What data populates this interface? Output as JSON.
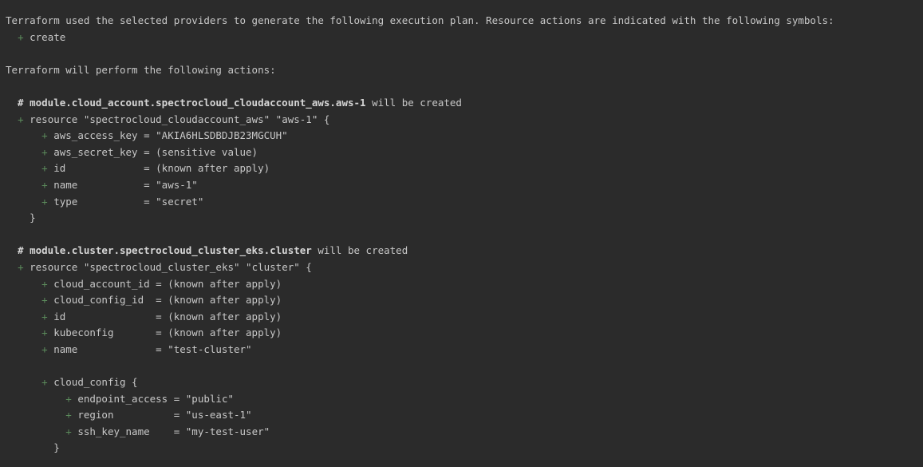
{
  "lines": [
    {
      "parts": [
        {
          "text": "Terraform used the selected providers to generate the following execution plan. Resource actions are indicated with the following symbols:",
          "style": "normal"
        }
      ]
    },
    {
      "parts": [
        {
          "text": "  ",
          "style": "normal"
        },
        {
          "text": "+",
          "style": "plus"
        },
        {
          "text": " create",
          "style": "normal"
        }
      ]
    },
    {
      "parts": []
    },
    {
      "parts": [
        {
          "text": "Terraform will perform the following actions:",
          "style": "normal"
        }
      ]
    },
    {
      "parts": []
    },
    {
      "parts": [
        {
          "text": "  # ",
          "style": "bold"
        },
        {
          "text": "module.cloud_account.spectrocloud_cloudaccount_aws.aws-1",
          "style": "bold"
        },
        {
          "text": " will be created",
          "style": "normal"
        }
      ]
    },
    {
      "parts": [
        {
          "text": "  ",
          "style": "normal"
        },
        {
          "text": "+",
          "style": "plus"
        },
        {
          "text": " resource \"spectrocloud_cloudaccount_aws\" \"aws-1\" {",
          "style": "normal"
        }
      ]
    },
    {
      "parts": [
        {
          "text": "      ",
          "style": "normal"
        },
        {
          "text": "+",
          "style": "plus"
        },
        {
          "text": " aws_access_key = \"AKIA6HLSDBDJB23MGCUH\"",
          "style": "normal"
        }
      ]
    },
    {
      "parts": [
        {
          "text": "      ",
          "style": "normal"
        },
        {
          "text": "+",
          "style": "plus"
        },
        {
          "text": " aws_secret_key = (sensitive value)",
          "style": "normal"
        }
      ]
    },
    {
      "parts": [
        {
          "text": "      ",
          "style": "normal"
        },
        {
          "text": "+",
          "style": "plus"
        },
        {
          "text": " id             = (known after apply)",
          "style": "normal"
        }
      ]
    },
    {
      "parts": [
        {
          "text": "      ",
          "style": "normal"
        },
        {
          "text": "+",
          "style": "plus"
        },
        {
          "text": " name           = \"aws-1\"",
          "style": "normal"
        }
      ]
    },
    {
      "parts": [
        {
          "text": "      ",
          "style": "normal"
        },
        {
          "text": "+",
          "style": "plus"
        },
        {
          "text": " type           = \"secret\"",
          "style": "normal"
        }
      ]
    },
    {
      "parts": [
        {
          "text": "    }",
          "style": "normal"
        }
      ]
    },
    {
      "parts": []
    },
    {
      "parts": [
        {
          "text": "  # ",
          "style": "bold"
        },
        {
          "text": "module.cluster.spectrocloud_cluster_eks.cluster",
          "style": "bold"
        },
        {
          "text": " will be created",
          "style": "normal"
        }
      ]
    },
    {
      "parts": [
        {
          "text": "  ",
          "style": "normal"
        },
        {
          "text": "+",
          "style": "plus"
        },
        {
          "text": " resource \"spectrocloud_cluster_eks\" \"cluster\" {",
          "style": "normal"
        }
      ]
    },
    {
      "parts": [
        {
          "text": "      ",
          "style": "normal"
        },
        {
          "text": "+",
          "style": "plus"
        },
        {
          "text": " cloud_account_id = (known after apply)",
          "style": "normal"
        }
      ]
    },
    {
      "parts": [
        {
          "text": "      ",
          "style": "normal"
        },
        {
          "text": "+",
          "style": "plus"
        },
        {
          "text": " cloud_config_id  = (known after apply)",
          "style": "normal"
        }
      ]
    },
    {
      "parts": [
        {
          "text": "      ",
          "style": "normal"
        },
        {
          "text": "+",
          "style": "plus"
        },
        {
          "text": " id               = (known after apply)",
          "style": "normal"
        }
      ]
    },
    {
      "parts": [
        {
          "text": "      ",
          "style": "normal"
        },
        {
          "text": "+",
          "style": "plus"
        },
        {
          "text": " kubeconfig       = (known after apply)",
          "style": "normal"
        }
      ]
    },
    {
      "parts": [
        {
          "text": "      ",
          "style": "normal"
        },
        {
          "text": "+",
          "style": "plus"
        },
        {
          "text": " name             = \"test-cluster\"",
          "style": "normal"
        }
      ]
    },
    {
      "parts": []
    },
    {
      "parts": [
        {
          "text": "      ",
          "style": "normal"
        },
        {
          "text": "+",
          "style": "plus"
        },
        {
          "text": " cloud_config {",
          "style": "normal"
        }
      ]
    },
    {
      "parts": [
        {
          "text": "          ",
          "style": "normal"
        },
        {
          "text": "+",
          "style": "plus"
        },
        {
          "text": " endpoint_access = \"public\"",
          "style": "normal"
        }
      ]
    },
    {
      "parts": [
        {
          "text": "          ",
          "style": "normal"
        },
        {
          "text": "+",
          "style": "plus"
        },
        {
          "text": " region          = \"us-east-1\"",
          "style": "normal"
        }
      ]
    },
    {
      "parts": [
        {
          "text": "          ",
          "style": "normal"
        },
        {
          "text": "+",
          "style": "plus"
        },
        {
          "text": " ssh_key_name    = \"my-test-user\"",
          "style": "normal"
        }
      ]
    },
    {
      "parts": [
        {
          "text": "        }",
          "style": "normal"
        }
      ]
    }
  ],
  "colors": {
    "background": "#2b2b2b",
    "text": "#c8c8c8",
    "plus": "#5b8a5b",
    "bold": "#d6d6d6"
  }
}
